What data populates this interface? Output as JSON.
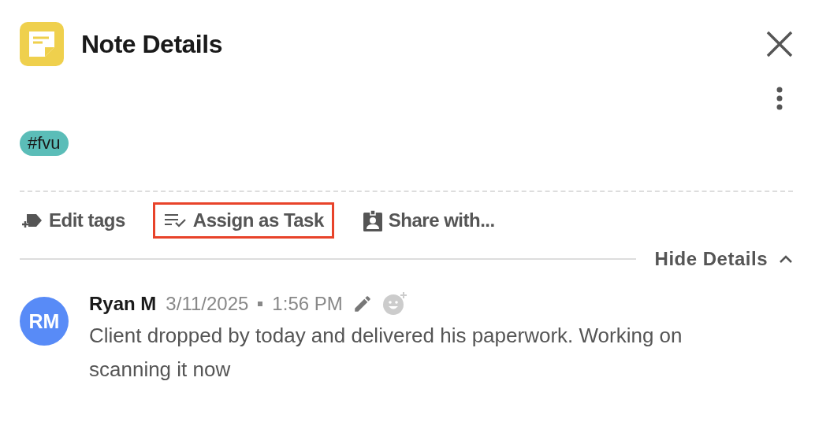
{
  "header": {
    "title": "Note Details"
  },
  "tags": [
    {
      "label": "#fvu",
      "color": "#5bbdb8"
    }
  ],
  "actions": [
    {
      "kind": "tag",
      "label": "Edit tags",
      "highlighted": false
    },
    {
      "kind": "task",
      "label": "Assign as Task",
      "highlighted": true
    },
    {
      "kind": "share",
      "label": "Share with...",
      "highlighted": false
    }
  ],
  "details_toggle": {
    "label": "Hide Details",
    "expanded": true
  },
  "comment": {
    "initials": "RM",
    "author": "Ryan M",
    "date": "3/11/2025",
    "time": "1:56 PM",
    "text": "Client dropped by today and delivered his paperwork. Working on scanning it now"
  }
}
